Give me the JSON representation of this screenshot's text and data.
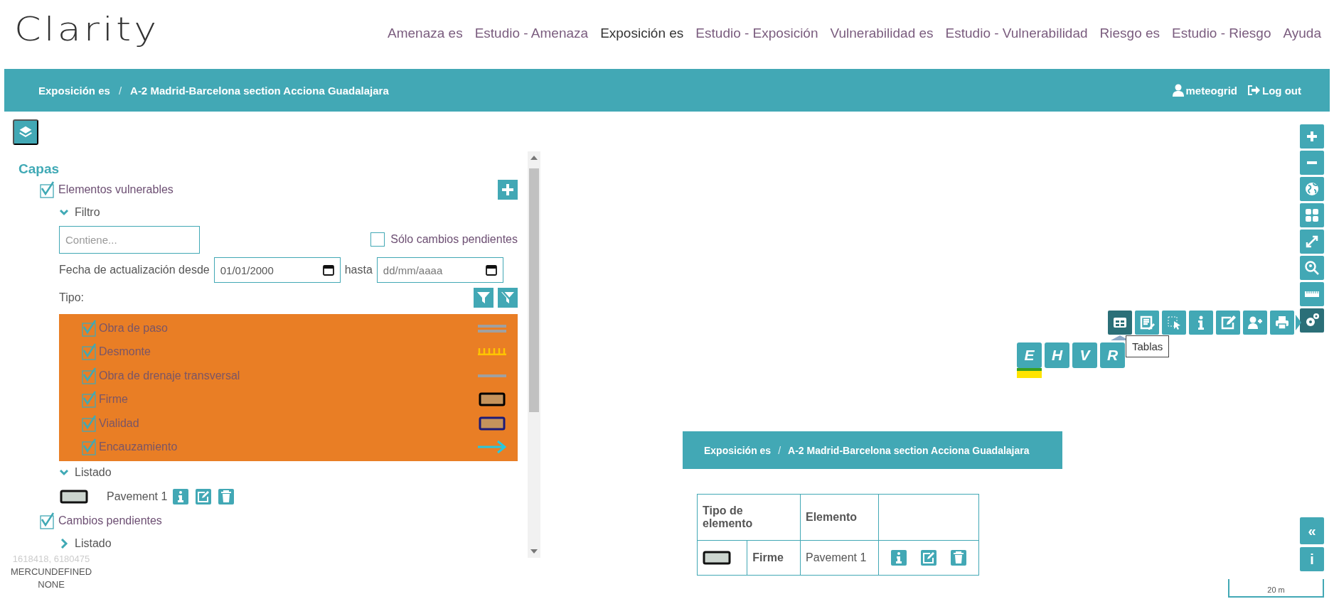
{
  "header": {
    "logo": "Clarity",
    "menu": [
      {
        "label": "Amenaza es",
        "selected": false
      },
      {
        "label": "Estudio - Amenaza",
        "selected": false
      },
      {
        "label": "Exposición es",
        "selected": true
      },
      {
        "label": "Estudio - Exposición",
        "selected": false
      },
      {
        "label": "Vulnerabilidad es",
        "selected": false
      },
      {
        "label": "Estudio - Vulnerabilidad",
        "selected": false
      },
      {
        "label": "Riesgo es",
        "selected": false
      },
      {
        "label": "Estudio - Riesgo",
        "selected": false
      },
      {
        "label": "Ayuda",
        "selected": false
      }
    ]
  },
  "breadcrumb": {
    "items": [
      "Exposición es",
      "A-2 Madrid-Barcelona section Acciona Guadalajara"
    ],
    "separator": "/",
    "user": "meteogrid",
    "logout": "Log out"
  },
  "layers_panel": {
    "title": "Capas",
    "groups": [
      {
        "label": "Elementos vulnerables",
        "checked": true,
        "filter": {
          "label": "Filtro",
          "expanded": true,
          "search_placeholder": "Contiene...",
          "pending_only": {
            "label": "Sólo cambios pendientes",
            "checked": false
          },
          "date_from_label": "Fecha de actualización desde",
          "date_from": "01/01/2000",
          "date_to_label": "hasta",
          "date_to_placeholder": "dd/mm/aaaa",
          "type_label": "Tipo:",
          "types": [
            {
              "label": "Obra de paso",
              "checked": true,
              "kind": "double"
            },
            {
              "label": "Desmonte",
              "checked": true,
              "kind": "comb"
            },
            {
              "label": "Obra de drenaje transversal",
              "checked": true,
              "kind": "line"
            },
            {
              "label": "Firme",
              "checked": true,
              "kind": "area",
              "color": "#000000"
            },
            {
              "label": "Vialidad",
              "checked": true,
              "kind": "area",
              "color": "#1c1a78"
            },
            {
              "label": "Encauzamiento",
              "checked": true,
              "kind": "arrow"
            }
          ]
        },
        "listing": {
          "label": "Listado",
          "expanded": true,
          "items": [
            {
              "name": "Pavement 1"
            }
          ]
        }
      },
      {
        "label": "Cambios pendientes",
        "checked": true,
        "listing": {
          "label": "Listado",
          "expanded": false
        }
      }
    ]
  },
  "map": {
    "controls": [
      {
        "kind": "zoom-in",
        "selected": false
      },
      {
        "kind": "zoom-out",
        "selected": false
      },
      {
        "kind": "globe",
        "selected": false
      },
      {
        "kind": "grid",
        "selected": false
      },
      {
        "kind": "expand",
        "selected": false
      },
      {
        "kind": "search",
        "selected": false
      },
      {
        "kind": "ruler",
        "selected": false
      },
      {
        "kind": "settings",
        "selected": true
      }
    ],
    "tools": [
      {
        "kind": "tables",
        "selected": true
      },
      {
        "kind": "list-edit",
        "selected": false
      },
      {
        "kind": "select",
        "selected": false
      },
      {
        "kind": "info",
        "selected": false
      },
      {
        "kind": "edit",
        "selected": false
      },
      {
        "kind": "add-user",
        "selected": false
      },
      {
        "kind": "print",
        "selected": false
      }
    ],
    "tooltip": "Tablas",
    "layer_letters": [
      {
        "label": "E",
        "selected": true
      },
      {
        "label": "H",
        "selected": false
      },
      {
        "label": "V",
        "selected": false
      },
      {
        "label": "R",
        "selected": false
      }
    ],
    "panel_buttons": [
      "«",
      "i"
    ],
    "scale": "20 m",
    "coordinates": "1618418, 6180475",
    "projection": "MERCUNDEFINED",
    "units": "NONE",
    "table_panel": {
      "breadcrumb": [
        "Exposición es",
        "A-2 Madrid-Barcelona section Acciona Guadalajara"
      ],
      "separator": "/",
      "columns": [
        "Tipo de elemento",
        "Elemento"
      ],
      "rows": [
        {
          "type": "Firme",
          "element": "Pavement 1"
        }
      ]
    }
  }
}
